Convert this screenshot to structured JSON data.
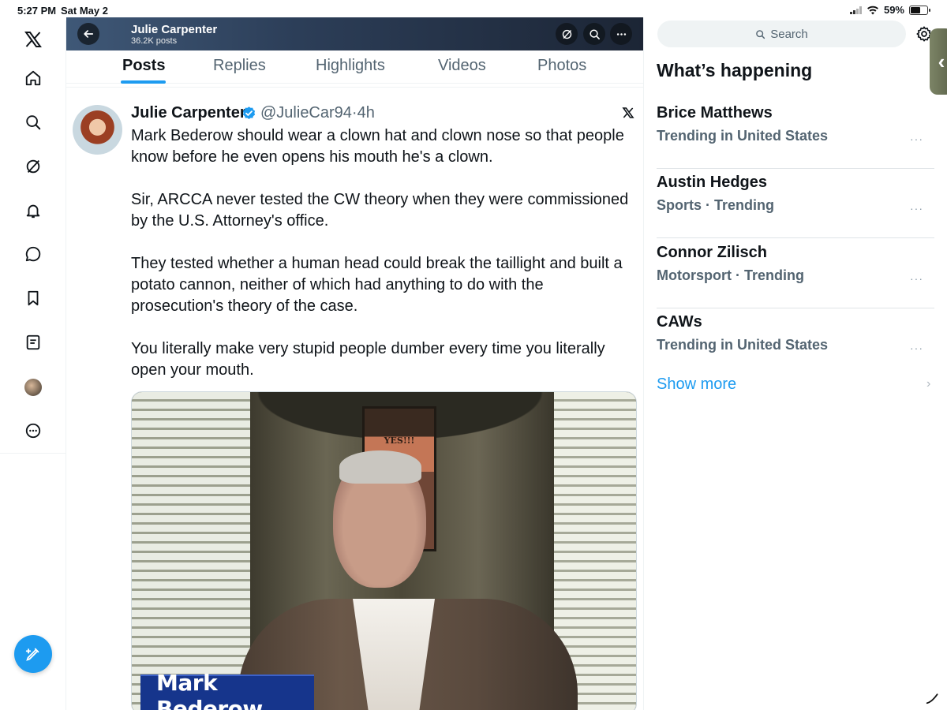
{
  "status_bar": {
    "time": "5:27 PM",
    "date": "Sat May 2",
    "battery": "59%"
  },
  "nav": {
    "items": [
      "x-logo",
      "home",
      "explore",
      "grok",
      "notifications",
      "messages",
      "bookmarks",
      "lists",
      "profile",
      "more"
    ]
  },
  "profile_header": {
    "name": "Julie Carpenter",
    "posts_count": "36.2K posts"
  },
  "tabs": [
    {
      "label": "Posts",
      "active": true
    },
    {
      "label": "Replies",
      "active": false
    },
    {
      "label": "Highlights",
      "active": false
    },
    {
      "label": "Videos",
      "active": false
    },
    {
      "label": "Photos",
      "active": false
    }
  ],
  "tweet": {
    "author": "Julie Carpenter",
    "handle": "@JulieCar94",
    "time": "4h",
    "verified": true,
    "paragraphs": [
      "Mark Bederow should wear a clown hat and clown nose so that people know before he even opens his mouth he's a clown.",
      "Sir, ARCCA never tested the CW theory when they were commissioned by the U.S. Attorney's office.",
      "They tested whether a human head could break the taillight and built a potato cannon, neither of which had anything to do with the prosecution's theory of the case.",
      "You literally make very stupid people dumber every time you literally open your mouth."
    ],
    "media": {
      "poster_text": "YES!!!",
      "lower_third": "Mark Bederow"
    }
  },
  "sidebar": {
    "search_placeholder": "Search",
    "title": "What’s happening",
    "trends": [
      {
        "name": "Brice Matthews",
        "meta": "Trending in United States"
      },
      {
        "name": "Austin Hedges",
        "meta": "Sports · Trending"
      },
      {
        "name": "Connor Zilisch",
        "meta": "Motorsport · Trending"
      },
      {
        "name": "CAWs",
        "meta": "Trending in United States"
      }
    ],
    "show_more": "Show more",
    "more_glyph": "···"
  },
  "colors": {
    "accent": "#1d9bf0",
    "text": "#0f1419",
    "secondary": "#536471"
  }
}
